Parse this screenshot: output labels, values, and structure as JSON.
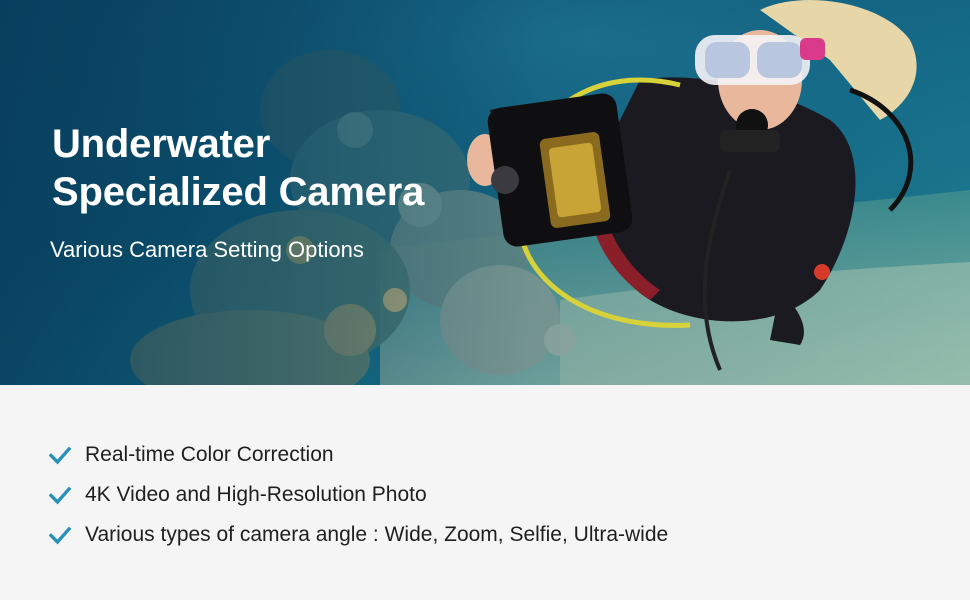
{
  "hero": {
    "title_line1": "Underwater",
    "title_line2": "Specialized Camera",
    "subtitle": "Various Camera Setting Options",
    "image": "scuba-diver-holding-underwater-camera-over-coral-reef"
  },
  "features": {
    "icon": "check-icon",
    "check_color": "#2a90b8",
    "items": [
      "Real-time Color Correction",
      "4K Video and High-Resolution Photo",
      "Various types of camera angle : Wide, Zoom, Selfie, Ultra-wide"
    ]
  },
  "colors": {
    "water_deep": "#0b4c6d",
    "water_light": "#2a8a96",
    "panel_background": "#f5f5f5",
    "text_dark": "#1f1f1f",
    "text_light": "#ffffff"
  }
}
